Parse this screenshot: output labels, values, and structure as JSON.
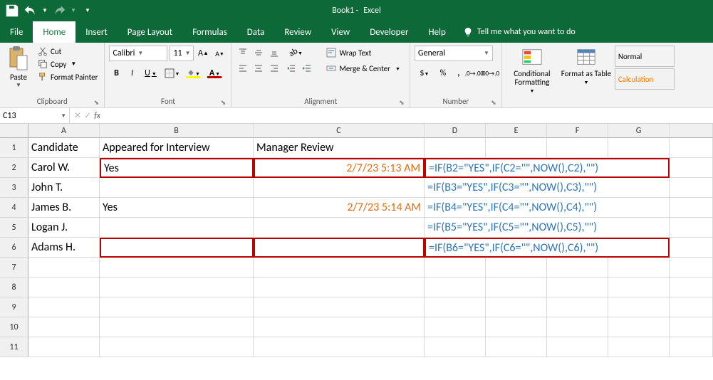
{
  "titlebar": {
    "doc": "Book1",
    "app": "Excel"
  },
  "tabs": {
    "file": "File",
    "home": "Home",
    "insert": "Insert",
    "page_layout": "Page Layout",
    "formulas": "Formulas",
    "data": "Data",
    "review": "Review",
    "view": "View",
    "developer": "Developer",
    "help": "Help"
  },
  "tellme": "Tell me what you want to do",
  "ribbon": {
    "clipboard": {
      "paste": "Paste",
      "cut": "Cut",
      "copy": "Copy",
      "format_painter": "Format Painter",
      "label": "Clipboard"
    },
    "font": {
      "name": "Calibri",
      "size": "11",
      "label": "Font"
    },
    "alignment": {
      "wrap": "Wrap Text",
      "merge": "Merge & Center",
      "label": "Alignment"
    },
    "number": {
      "format": "General",
      "label": "Number"
    },
    "styles": {
      "cond": "Conditional Formatting",
      "table": "Format as Table",
      "normal": "Normal",
      "calc": "Calculation"
    }
  },
  "namebox": "C13",
  "formula": "",
  "columns": [
    "A",
    "B",
    "C",
    "D",
    "E",
    "F",
    "G"
  ],
  "headers": {
    "A": "Candidate",
    "B": "Appeared for Interview",
    "C": "Manager Review"
  },
  "rows": [
    {
      "n": 1
    },
    {
      "n": 2,
      "A": "Carol W.",
      "B": "Yes",
      "C": "2/7/23 5:13 AM",
      "F": "=IF(B2=\"YES\",IF(C2=\"\",NOW(),C2),\"\")",
      "hlB": true,
      "hlC": true,
      "hlF": true
    },
    {
      "n": 3,
      "A": "John T.",
      "F": "=IF(B3=\"YES\",IF(C3=\"\",NOW(),C3),\"\")"
    },
    {
      "n": 4,
      "A": "James B.",
      "B": "Yes",
      "C": "2/7/23 5:14 AM",
      "F": "=IF(B4=\"YES\",IF(C4=\"\",NOW(),C4),\"\")"
    },
    {
      "n": 5,
      "A": "Logan J.",
      "F": "=IF(B5=\"YES\",IF(C5=\"\",NOW(),C5),\"\")"
    },
    {
      "n": 6,
      "A": "Adams H.",
      "F": "=IF(B6=\"YES\",IF(C6=\"\",NOW(),C6),\"\")",
      "hlB": true,
      "hlC": true,
      "hlF": true
    },
    {
      "n": 7
    },
    {
      "n": 8
    },
    {
      "n": 9
    },
    {
      "n": 10
    },
    {
      "n": 11
    }
  ]
}
